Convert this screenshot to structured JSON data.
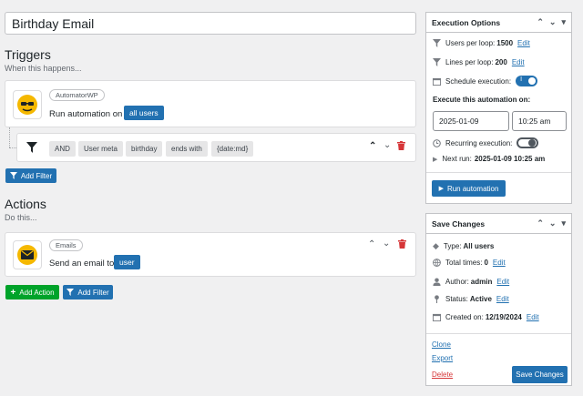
{
  "automation": {
    "title": "Birthday Email"
  },
  "triggers": {
    "heading": "Triggers",
    "subheading": "When this happens...",
    "item": {
      "integration": "AutomatorWP",
      "text_prefix": "Run automation on",
      "tag": "all users"
    },
    "filter": {
      "tags": [
        "AND",
        "User meta",
        "birthday",
        "ends with",
        "{date:md}"
      ]
    },
    "add_filter_label": "Add Filter"
  },
  "actions": {
    "heading": "Actions",
    "subheading": "Do this...",
    "item": {
      "integration": "Emails",
      "text_prefix": "Send an email to",
      "tag": "user"
    },
    "add_action_label": "Add Action",
    "add_filter_label": "Add Filter"
  },
  "execution_options": {
    "title": "Execution Options",
    "users_per_loop_label": "Users per loop:",
    "users_per_loop_value": "1500",
    "lines_per_loop_label": "Lines per loop:",
    "lines_per_loop_value": "200",
    "edit_label": "Edit",
    "schedule_label": "Schedule execution:",
    "schedule_toggle_text": "I",
    "execute_on_label": "Execute this automation on:",
    "date": "2025-01-09",
    "time": "10:25 am",
    "recurring_label": "Recurring execution:",
    "next_run_label": "Next run:",
    "next_run_value": "2025-01-09 10:25 am",
    "run_button": "Run automation"
  },
  "save_changes": {
    "title": "Save Changes",
    "type_label": "Type:",
    "type_value": "All users",
    "total_label": "Total times:",
    "total_value": "0",
    "edit_label": "Edit",
    "author_label": "Author:",
    "author_value": "admin",
    "status_label": "Status:",
    "status_value": "Active",
    "created_label": "Created on:",
    "created_value": "12/19/2024",
    "clone": "Clone",
    "export": "Export",
    "delete": "Delete",
    "save_button": "Save Changes"
  },
  "colors": {
    "primary": "#2271b1",
    "success": "#00a32a",
    "danger": "#d63638"
  }
}
